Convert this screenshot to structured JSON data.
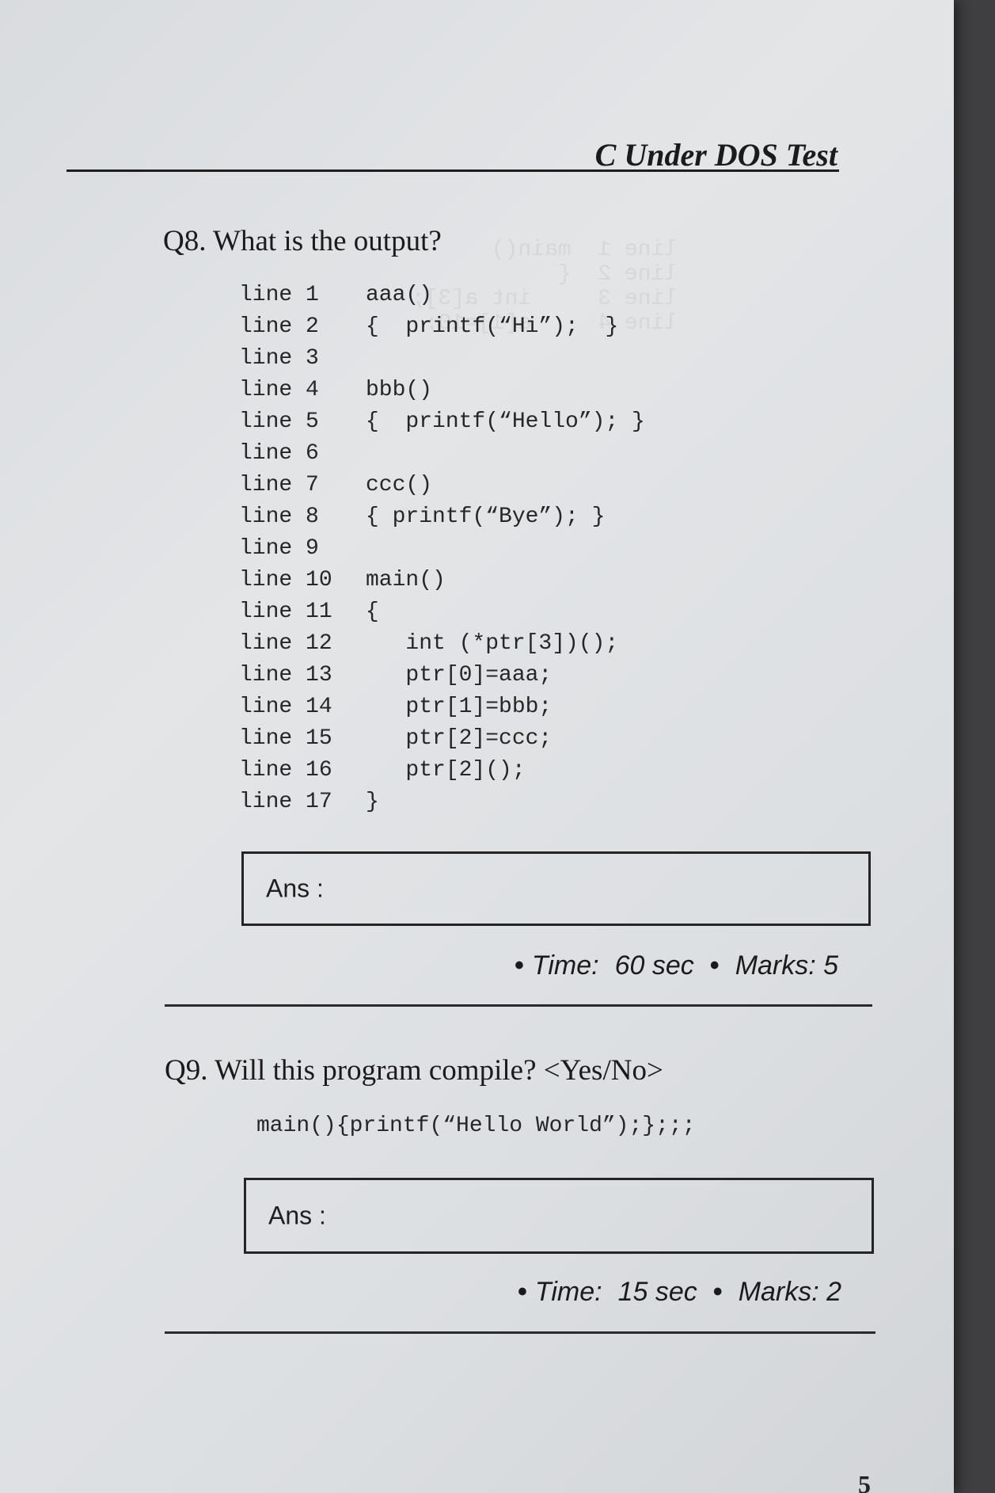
{
  "header": {
    "title": "C Under DOS Test"
  },
  "q8": {
    "question": "Q8. What is the output?",
    "code": [
      {
        "ln": "line 1",
        "code": "aaa()"
      },
      {
        "ln": "line 2",
        "code": "{  printf(“Hi”);  }"
      },
      {
        "ln": "line 3",
        "code": ""
      },
      {
        "ln": "line 4",
        "code": "bbb()"
      },
      {
        "ln": "line 5",
        "code": "{  printf(“Hello”); }"
      },
      {
        "ln": "line 6",
        "code": ""
      },
      {
        "ln": "line 7",
        "code": "ccc()"
      },
      {
        "ln": "line 8",
        "code": "{ printf(“Bye”); }"
      },
      {
        "ln": "line 9",
        "code": ""
      },
      {
        "ln": "line 10",
        "code": "main()"
      },
      {
        "ln": "line 11",
        "code": "{"
      },
      {
        "ln": "line 12",
        "code": "   int (*ptr[3])();"
      },
      {
        "ln": "line 13",
        "code": "   ptr[0]=aaa;"
      },
      {
        "ln": "line 14",
        "code": "   ptr[1]=bbb;"
      },
      {
        "ln": "line 15",
        "code": "   ptr[2]=ccc;"
      },
      {
        "ln": "line 16",
        "code": "   ptr[2]();"
      },
      {
        "ln": "line 17",
        "code": "}"
      }
    ],
    "answer_label": "Ans :",
    "time_label": "Time:",
    "time_value": "60 sec",
    "marks_label": "Marks:",
    "marks_value": "5"
  },
  "q9": {
    "question": "Q9. Will this program compile? <Yes/No>",
    "code": "main(){printf(“Hello World”);};;;",
    "answer_label": "Ans :",
    "time_label": "Time:",
    "time_value": "15 sec",
    "marks_label": "Marks:",
    "marks_value": "2"
  },
  "page_number": "5"
}
